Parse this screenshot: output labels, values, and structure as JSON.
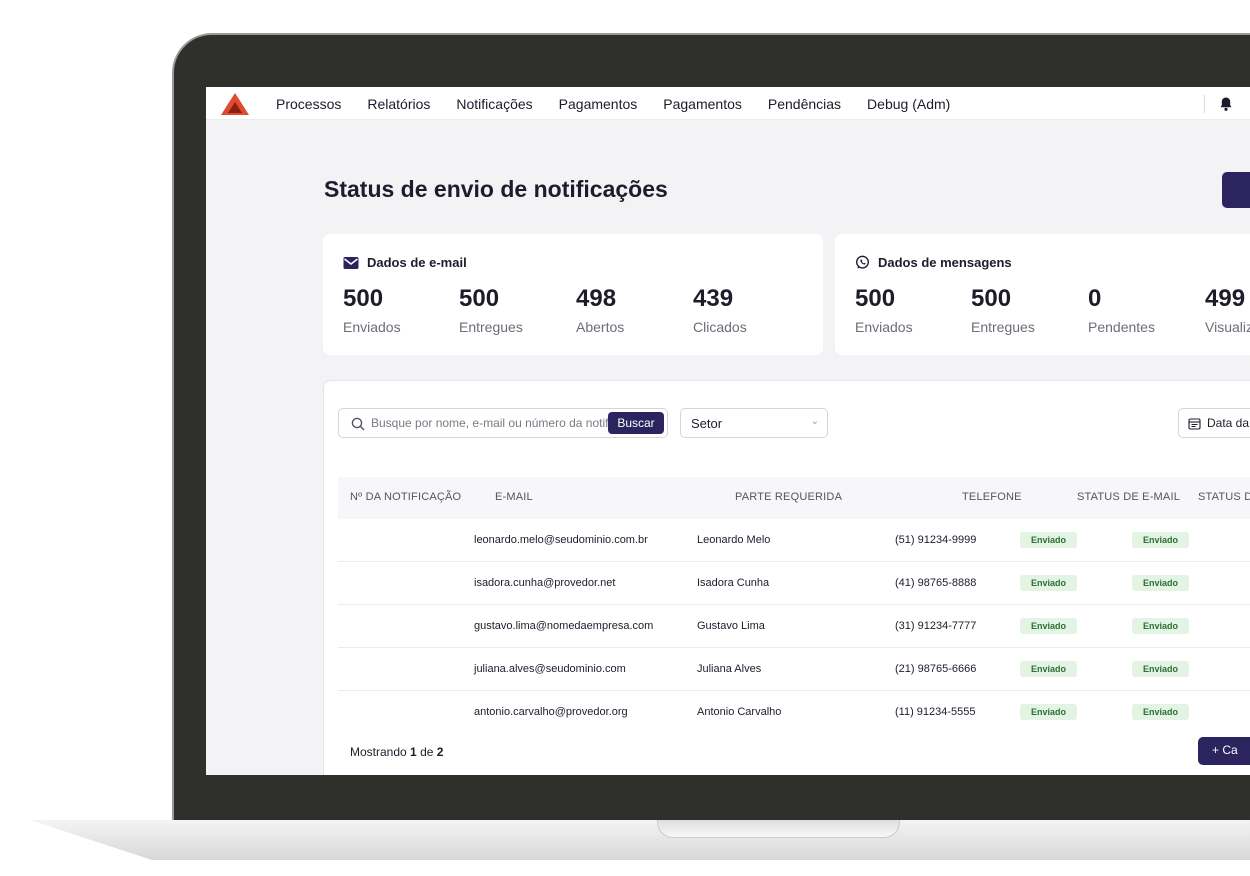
{
  "nav": {
    "items": [
      "Processos",
      "Relatórios",
      "Notificações",
      "Pagamentos",
      "Pagamentos",
      "Pendências",
      "Debug (Adm)"
    ],
    "icons": {
      "logo": "triangle-logo-icon",
      "bell": "bell-icon"
    }
  },
  "page": {
    "title": "Status de envio de notificações"
  },
  "email_card": {
    "title": "Dados de e-mail",
    "icon": "envelope-icon",
    "stats": [
      {
        "value": "500",
        "label": "Enviados"
      },
      {
        "value": "500",
        "label": "Entregues"
      },
      {
        "value": "498",
        "label": "Abertos"
      },
      {
        "value": "439",
        "label": "Clicados"
      }
    ]
  },
  "msg_card": {
    "title": "Dados de mensagens",
    "icon": "whatsapp-icon",
    "stats": [
      {
        "value": "500",
        "label": "Enviados"
      },
      {
        "value": "500",
        "label": "Entregues"
      },
      {
        "value": "0",
        "label": "Pendentes"
      },
      {
        "value": "499",
        "label": "Visualiz"
      }
    ]
  },
  "filters": {
    "search_placeholder": "Busque por nome, e-mail ou número da notif",
    "search_button": "Buscar",
    "setor": "Setor",
    "date": "Data da"
  },
  "table": {
    "headers": [
      "Nº DA NOTIFICAÇÃO",
      "E-MAIL",
      "PARTE REQUERIDA",
      "TELEFONE",
      "STATUS DE E-MAIL",
      "STATUS D"
    ],
    "rows": [
      {
        "email": "leonardo.melo@seudominio.com.br",
        "name": "Leonardo Melo",
        "phone": "(51) 91234-9999",
        "s1": "Enviado",
        "s2": "Enviado"
      },
      {
        "email": "isadora.cunha@provedor.net",
        "name": "Isadora Cunha",
        "phone": "(41) 98765-8888",
        "s1": "Enviado",
        "s2": "Enviado"
      },
      {
        "email": "gustavo.lima@nomedaempresa.com",
        "name": "Gustavo Lima",
        "phone": "(31) 91234-7777",
        "s1": "Enviado",
        "s2": "Enviado"
      },
      {
        "email": "juliana.alves@seudominio.com",
        "name": "Juliana Alves",
        "phone": "(21) 98765-6666",
        "s1": "Enviado",
        "s2": "Enviado"
      },
      {
        "email": "antonio.carvalho@provedor.org",
        "name": "Antonio Carvalho",
        "phone": "(11) 91234-5555",
        "s1": "Enviado",
        "s2": "Enviado"
      }
    ]
  },
  "footer": {
    "showing_prefix": "Mostrando",
    "current_page": "1",
    "of": "de",
    "total_pages": "2",
    "load_button": "+ Ca"
  },
  "colors": {
    "primary": "#2b245e",
    "accent_logo": "#e04a2f",
    "badge_bg": "#e3f4e4",
    "badge_text": "#2c6e35"
  }
}
